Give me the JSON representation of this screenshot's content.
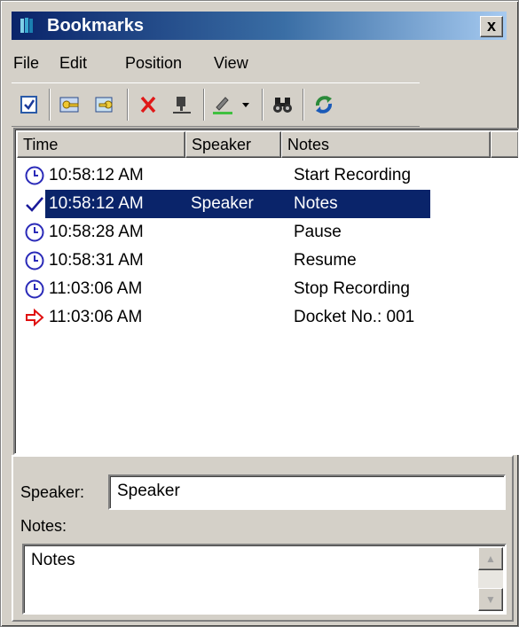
{
  "window": {
    "title": "Bookmarks",
    "close_label": "x"
  },
  "menu": [
    "File",
    "Edit",
    "Position",
    "View"
  ],
  "toolbar": {
    "buttons": [
      "check-note-icon",
      "key-icon",
      "key-folder-icon",
      "delete-icon",
      "insert-marker-icon",
      "highlight-pen-icon",
      "dropdown-arrow-icon",
      "find-binoculars-icon",
      "refresh-icon"
    ]
  },
  "list": {
    "columns": [
      "Time",
      "Speaker",
      "Notes"
    ],
    "rows": [
      {
        "icon": "clock-icon",
        "time": "10:58:12 AM",
        "speaker": "",
        "notes": "Start Recording",
        "selected": false
      },
      {
        "icon": "check-icon",
        "time": "10:58:12 AM",
        "speaker": "Speaker",
        "notes": "Notes",
        "selected": true
      },
      {
        "icon": "clock-icon",
        "time": "10:58:28 AM",
        "speaker": "",
        "notes": "Pause",
        "selected": false
      },
      {
        "icon": "clock-icon",
        "time": "10:58:31 AM",
        "speaker": "",
        "notes": "Resume",
        "selected": false
      },
      {
        "icon": "clock-icon",
        "time": "11:03:06 AM",
        "speaker": "",
        "notes": "Stop Recording",
        "selected": false
      },
      {
        "icon": "arrow-icon",
        "time": "11:03:06 AM",
        "speaker": "",
        "notes": "Docket No.: 001",
        "selected": false
      }
    ]
  },
  "details": {
    "speaker_label": "Speaker:",
    "speaker_value": "Speaker",
    "notes_label": "Notes:",
    "notes_value": "Notes"
  },
  "colors": {
    "selection": "#0a246a",
    "icon_blue": "#2a2ab8",
    "arrow_red": "#e01010"
  }
}
